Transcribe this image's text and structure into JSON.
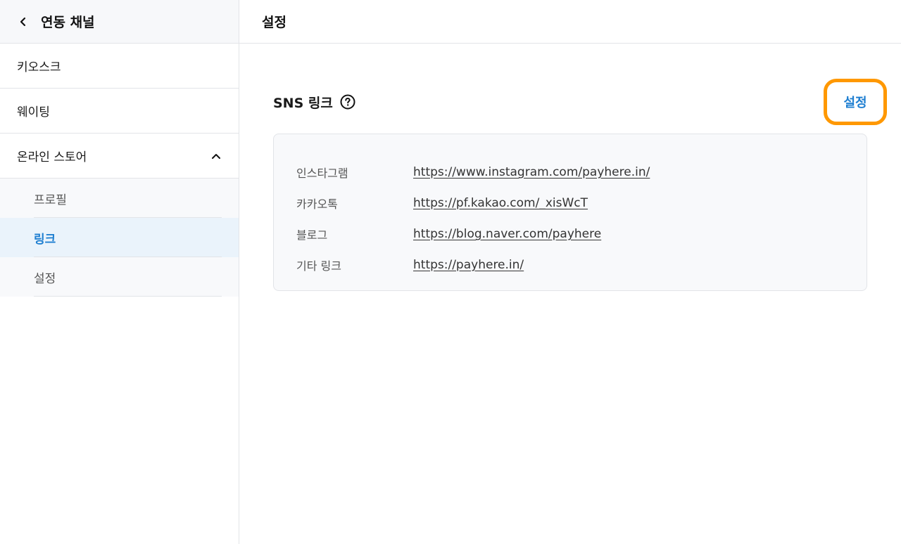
{
  "sidebar": {
    "title": "연동 채널",
    "back_icon": "chevron-left-icon",
    "items": [
      {
        "label": "키오스크"
      },
      {
        "label": "웨이팅"
      },
      {
        "label": "온라인 스토어",
        "expanded": true,
        "icon": "chevron-up-icon"
      }
    ],
    "subitems": [
      {
        "label": "프로필",
        "active": false
      },
      {
        "label": "링크",
        "active": true
      },
      {
        "label": "설정",
        "active": false
      }
    ]
  },
  "main": {
    "title": "설정",
    "section": {
      "title": "SNS 링크",
      "help_icon": "question-circle-icon",
      "settings_button": "설정"
    },
    "links": [
      {
        "label": "인스타그램",
        "url": "https://www.instagram.com/payhere.in/"
      },
      {
        "label": "카카오톡",
        "url": "https://pf.kakao.com/_xisWcT"
      },
      {
        "label": "블로그",
        "url": "https://blog.naver.com/payhere"
      },
      {
        "label": "기타 링크",
        "url": "https://payhere.in/"
      }
    ]
  },
  "colors": {
    "accent": "#1f7fd1",
    "highlight_border": "#ff9800",
    "active_bg": "#eaf3fb"
  }
}
